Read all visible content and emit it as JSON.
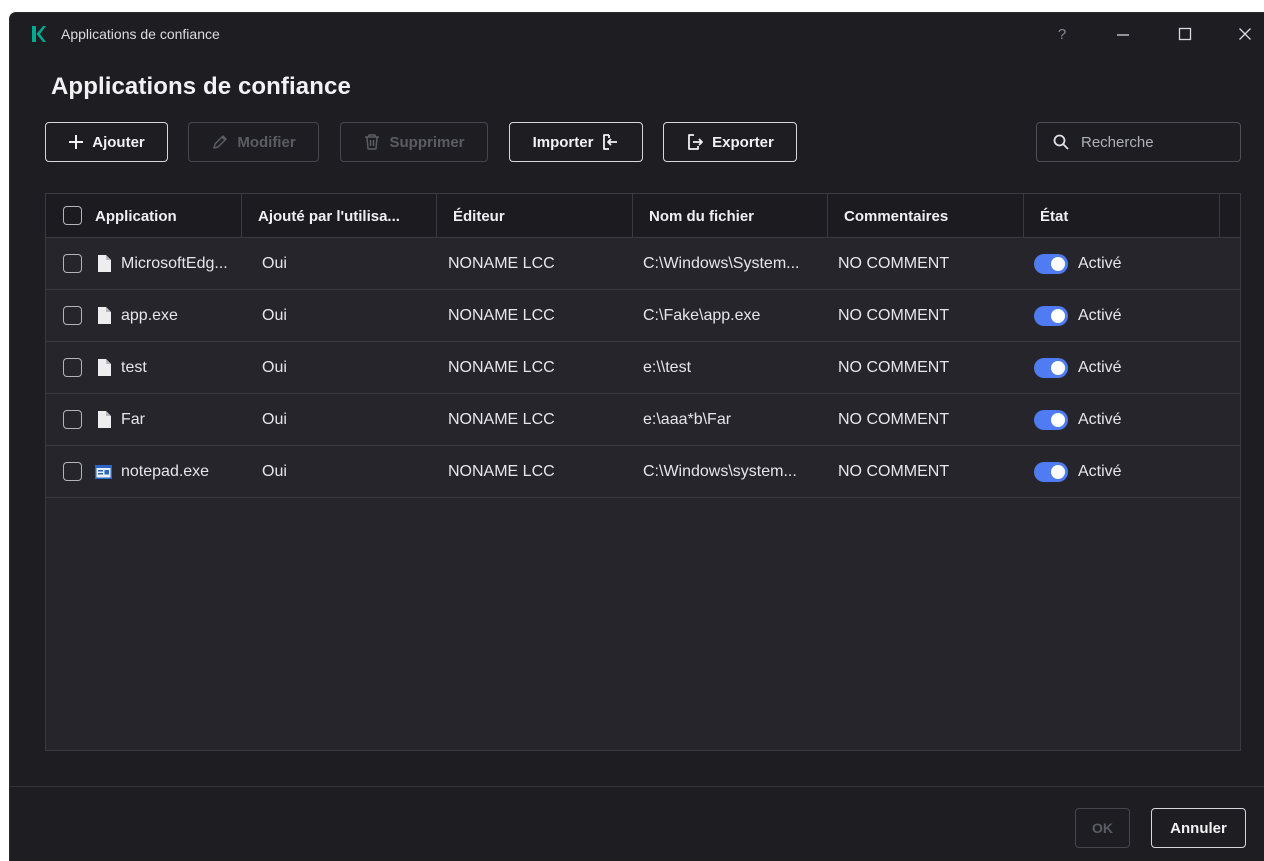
{
  "window": {
    "title": "Applications de confiance",
    "help_label": "?"
  },
  "page": {
    "title": "Applications de confiance"
  },
  "toolbar": {
    "add_label": "Ajouter",
    "modify_label": "Modifier",
    "delete_label": "Supprimer",
    "import_label": "Importer",
    "export_label": "Exporter"
  },
  "search": {
    "placeholder": "Recherche"
  },
  "table": {
    "columns": [
      "Application",
      "Ajouté par l'utilisa...",
      "Éditeur",
      "Nom du fichier",
      "Commentaires",
      "État"
    ],
    "rows": [
      {
        "application": "MicrosoftEdg...",
        "icon": "file-icon",
        "added_by_user": "Oui",
        "publisher": "NONAME LCC",
        "filename": "C:\\Windows\\System...",
        "comment": "NO COMMENT",
        "state": "Activé",
        "enabled": true
      },
      {
        "application": "app.exe",
        "icon": "file-icon",
        "added_by_user": "Oui",
        "publisher": "NONAME LCC",
        "filename": "C:\\Fake\\app.exe",
        "comment": "NO COMMENT",
        "state": "Activé",
        "enabled": true
      },
      {
        "application": "test",
        "icon": "file-icon",
        "added_by_user": "Oui",
        "publisher": "NONAME LCC",
        "filename": "e:\\\\test",
        "comment": "NO COMMENT",
        "state": "Activé",
        "enabled": true
      },
      {
        "application": "Far",
        "icon": "file-icon",
        "added_by_user": "Oui",
        "publisher": "NONAME LCC",
        "filename": "e:\\aaa*b\\Far",
        "comment": "NO COMMENT",
        "state": "Activé",
        "enabled": true
      },
      {
        "application": "notepad.exe",
        "icon": "notepad-app-icon",
        "added_by_user": "Oui",
        "publisher": "NONAME LCC",
        "filename": "C:\\Windows\\system...",
        "comment": "NO COMMENT",
        "state": "Activé",
        "enabled": true
      }
    ]
  },
  "footer": {
    "ok_label": "OK",
    "cancel_label": "Annuler"
  },
  "colors": {
    "background": "#1d1d22",
    "table_background": "#25252b",
    "accent_toggle": "#4f7cf2",
    "brand_logo": "#00a88e"
  }
}
